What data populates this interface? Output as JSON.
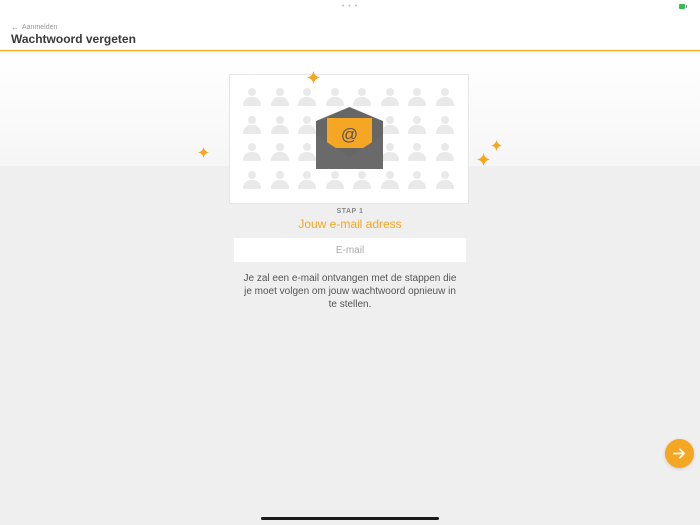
{
  "status_bar": {
    "dots": "• • •",
    "battery_icon": "battery-icon"
  },
  "header": {
    "back_label": "Aanmelden",
    "back_icon": "arrow-left-icon",
    "title": "Wachtwoord vergeten"
  },
  "colors": {
    "accent": "#f5a623",
    "envelope": "#666666",
    "background": "#efefef"
  },
  "illustration": {
    "envelope_symbol": "@",
    "icon": "envelope-at-icon"
  },
  "step": {
    "label": "STAP 1",
    "title": "Jouw e-mail adress"
  },
  "email_field": {
    "placeholder": "E-mail",
    "value": ""
  },
  "info_text": "Je zal een e-mail ontvangen met de stappen die je moet volgen om jouw wachtwoord opnieuw in te stellen.",
  "next_button": {
    "icon": "arrow-right-icon"
  }
}
